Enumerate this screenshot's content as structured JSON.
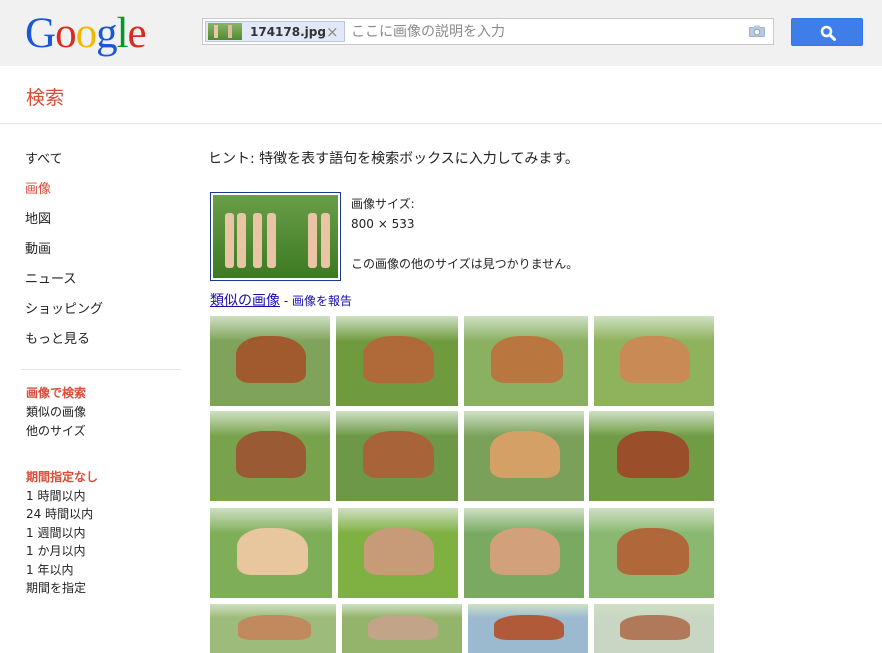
{
  "logo": {
    "letters": [
      "G",
      "o",
      "o",
      "g",
      "l",
      "e"
    ]
  },
  "search": {
    "chip_filename": "174178.jpg",
    "chip_remove": "×",
    "placeholder": "ここに画像の説明を入力",
    "value": ""
  },
  "section_title": "検索",
  "nav": {
    "items": [
      {
        "label": "すべて",
        "active": false
      },
      {
        "label": "画像",
        "active": true
      },
      {
        "label": "地図",
        "active": false
      },
      {
        "label": "動画",
        "active": false
      },
      {
        "label": "ニュース",
        "active": false
      },
      {
        "label": "ショッピング",
        "active": false
      },
      {
        "label": "もっと見る",
        "active": false
      }
    ]
  },
  "tools": {
    "head": "画像で検索",
    "items": [
      "類似の画像",
      "他のサイズ"
    ]
  },
  "time_filter": {
    "head": "期間指定なし",
    "items": [
      "1 時間以内",
      "24 時間以内",
      "1 週間以内",
      "1 か月以内",
      "1 年以内",
      "期間を指定"
    ]
  },
  "main": {
    "hint": "ヒント: 特徴を表す語句を検索ボックスに入力してみます。",
    "image_size_label": "画像サイズ:",
    "image_size_value": "800 × 533",
    "no_other_sizes": "この画像の他のサイズは見つかりません。",
    "similar_link": "類似の画像",
    "separator": " - ",
    "report_link": "画像を報告"
  },
  "colors": {
    "accent_red": "#dd4b39",
    "link_blue": "#1a0dab",
    "search_button": "#3f7ee8"
  },
  "thumbnails": [
    {
      "subject": "brown-white horses on grass",
      "palette": [
        "#7fa35a",
        "#a15a2e"
      ]
    },
    {
      "subject": "brown cow with black cattle",
      "palette": [
        "#6f9a3e",
        "#b06a3a"
      ]
    },
    {
      "subject": "foal and horses on grass",
      "palette": [
        "#8ab062",
        "#b9773f"
      ]
    },
    {
      "subject": "foal held by person",
      "palette": [
        "#8fb25c",
        "#c98a55"
      ]
    },
    {
      "subject": "pinto horse on grass",
      "palette": [
        "#78a24c",
        "#9a5a34"
      ]
    },
    {
      "subject": "grazing brown-white cow",
      "palette": [
        "#6d9848",
        "#a86438"
      ]
    },
    {
      "subject": "building with awning",
      "palette": [
        "#7aa05a",
        "#d4a066"
      ]
    },
    {
      "subject": "brown horse on grass",
      "palette": [
        "#6f9c44",
        "#9a4f2a"
      ]
    },
    {
      "subject": "blonde girl close-up",
      "palette": [
        "#7fae58",
        "#e8c69e"
      ]
    },
    {
      "subject": "green jacket hands",
      "palette": [
        "#7fb042",
        "#c79a78"
      ]
    },
    {
      "subject": "3d characters on grass",
      "palette": [
        "#7aaa62",
        "#d2a07a"
      ]
    },
    {
      "subject": "chestnut horse standing",
      "palette": [
        "#8ab870",
        "#b0683a"
      ]
    },
    {
      "subject": "horse and foal",
      "palette": [
        "#9dbb7a",
        "#c08a5e"
      ]
    },
    {
      "subject": "small bird in hand",
      "palette": [
        "#93b46a",
        "#c2a488"
      ]
    },
    {
      "subject": "brick pillars and trees",
      "palette": [
        "#9bbad0",
        "#b05a3a"
      ]
    },
    {
      "subject": "clay pots",
      "palette": [
        "#c9d6c4",
        "#b07a5a"
      ]
    }
  ]
}
